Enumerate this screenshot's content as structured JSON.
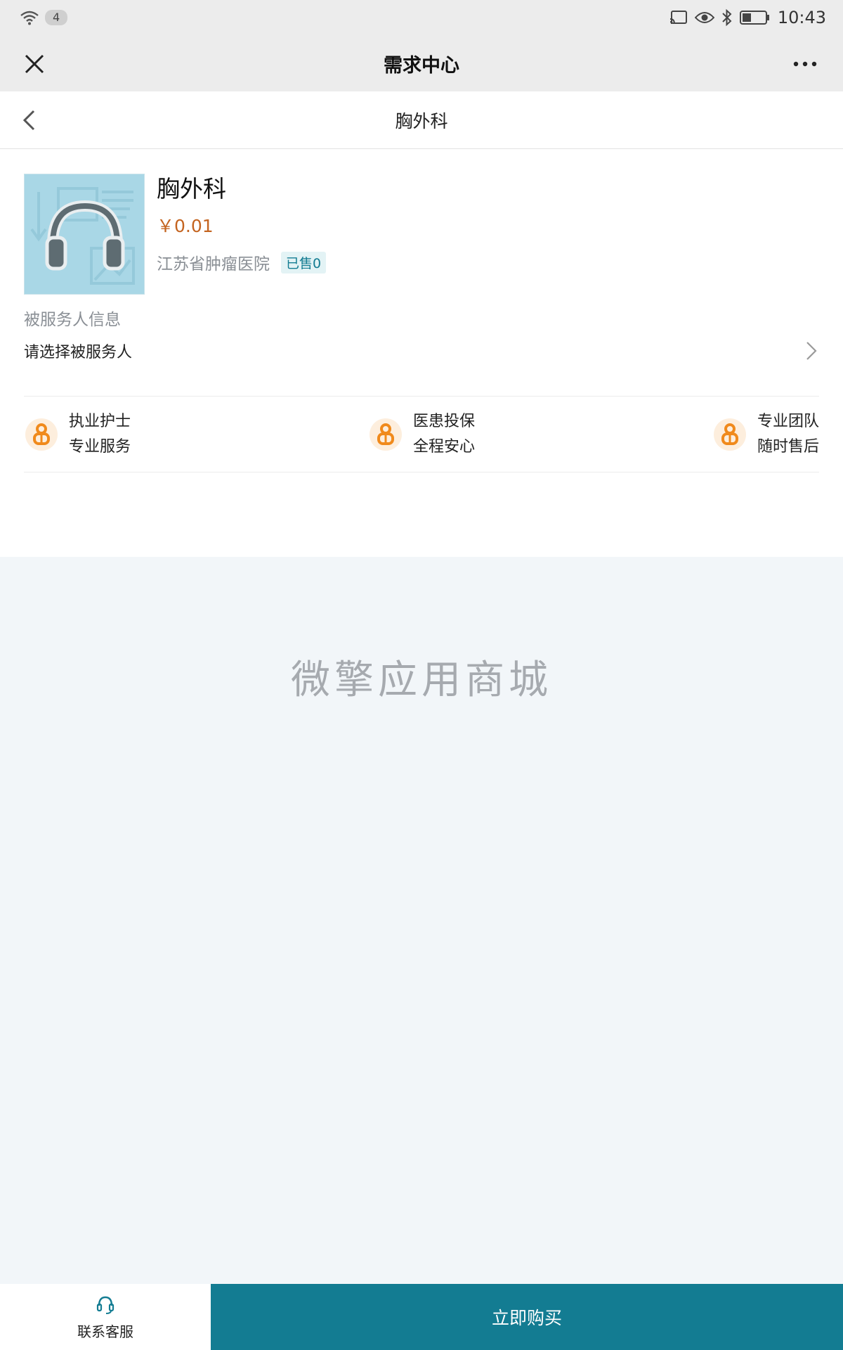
{
  "status_bar": {
    "sim_count": "4",
    "time": "10:43"
  },
  "title_bar": {
    "title": "需求中心"
  },
  "page_header": {
    "title": "胸外科"
  },
  "product": {
    "name": "胸外科",
    "price": "￥0.01",
    "hospital": "江苏省肿瘤医院",
    "sold": "已售0"
  },
  "service": {
    "label": "被服务人信息",
    "placeholder": "请选择被服务人"
  },
  "features": [
    {
      "line1": "执业护士",
      "line2": "专业服务"
    },
    {
      "line1": "医患投保",
      "line2": "全程安心"
    },
    {
      "line1": "专业团队",
      "line2": "随时售后"
    }
  ],
  "watermark": "微擎应用商城",
  "bottom_bar": {
    "customer_service_label": "联系客服",
    "buy_label": "立即购买"
  },
  "colors": {
    "accent": "#137c92",
    "price": "#c46420",
    "feature_icon": "#f08a1c"
  },
  "icons": {
    "close": "close-icon",
    "more": "more-dots-icon",
    "back": "chevron-left-icon",
    "select": "chevron-right-icon",
    "thumbnail": "headphones-icon",
    "feature": "badge-icon",
    "customer_service": "headset-icon"
  }
}
